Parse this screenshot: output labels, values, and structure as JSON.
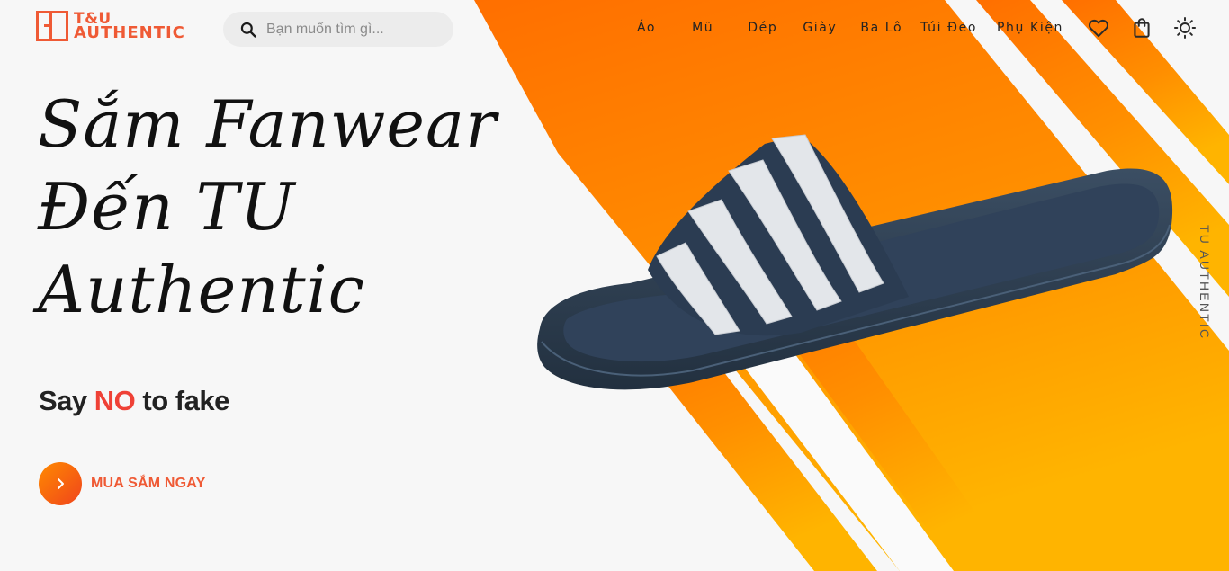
{
  "brand": {
    "logo_line1": "T&U",
    "logo_line2": "AUTHENTIC",
    "accent_color": "#ef5a35"
  },
  "search": {
    "placeholder": "Bạn muốn tìm gì..."
  },
  "nav": {
    "items": [
      "Áo",
      "Mũ",
      "Dép",
      "Giày",
      "Ba Lô",
      "Túi Đeo",
      "Phụ Kiện"
    ],
    "icons": [
      "heart-icon",
      "shopping-bag-icon",
      "sun-icon"
    ]
  },
  "hero": {
    "title_lines": [
      "Sắm Fanwear",
      "Đến TU",
      "Authentic"
    ],
    "tagline_before": "Say ",
    "tagline_accent": "NO",
    "tagline_after": " to fake",
    "cta_label": "MUA SẮM NGAY",
    "side_text": "TU AUTHENTIC",
    "product_image": "navy-slide-sandal-white-stripes",
    "stripe_colors": [
      "#ff7300",
      "#ffb000"
    ]
  }
}
